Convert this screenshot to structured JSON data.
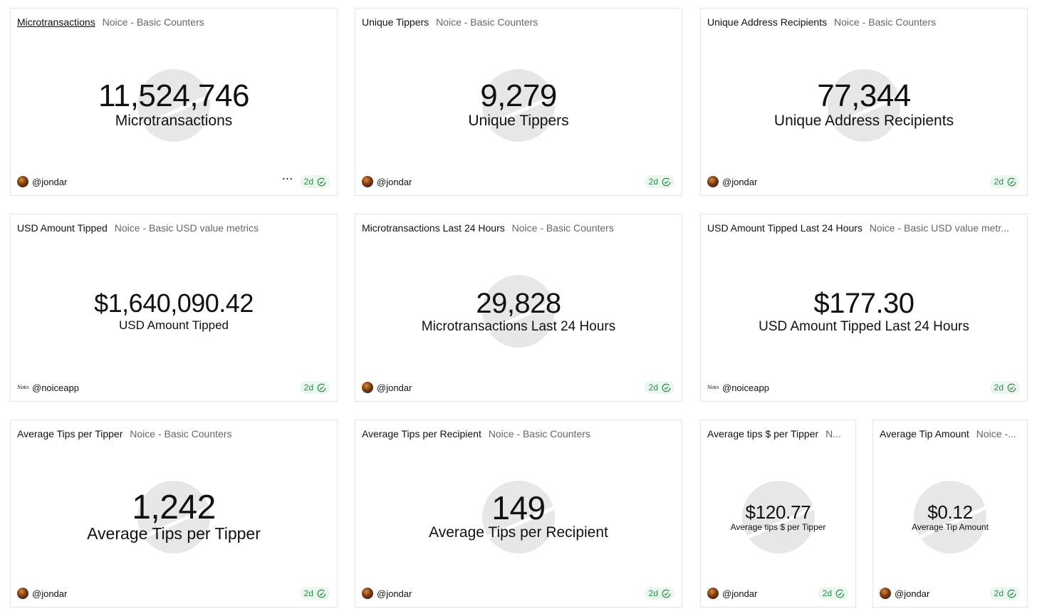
{
  "cards": [
    {
      "title": "Microtransactions",
      "source": "Noice - Basic Counters",
      "value": "11,524,746",
      "label": "Microtransactions",
      "owner": "@jondar",
      "age": "2d"
    },
    {
      "title": "Unique Tippers",
      "source": "Noice - Basic Counters",
      "value": "9,279",
      "label": "Unique Tippers",
      "owner": "@jondar",
      "age": "2d"
    },
    {
      "title": "Unique Address Recipients",
      "source": "Noice - Basic Counters",
      "value": "77,344",
      "label": "Unique Address Recipients",
      "owner": "@jondar",
      "age": "2d"
    },
    {
      "title": "USD Amount Tipped",
      "source": "Noice - Basic USD value metrics",
      "value": "$1,640,090.42",
      "label": "USD Amount Tipped",
      "owner": "@noiceapp",
      "owner_avatar_text": "Noice",
      "age": "2d"
    },
    {
      "title": "Microtransactions Last 24 Hours",
      "source": "Noice - Basic Counters",
      "value": "29,828",
      "label": "Microtransactions Last 24 Hours",
      "owner": "@jondar",
      "age": "2d"
    },
    {
      "title": "USD Amount Tipped Last 24 Hours",
      "source": "Noice - Basic USD value metr...",
      "value": "$177.30",
      "label": "USD Amount Tipped Last 24 Hours",
      "owner": "@noiceapp",
      "owner_avatar_text": "Noice",
      "age": "2d"
    },
    {
      "title": "Average Tips per Tipper",
      "source": "Noice - Basic Counters",
      "value": "1,242",
      "label": "Average Tips per Tipper",
      "owner": "@jondar",
      "age": "2d"
    },
    {
      "title": "Average Tips per Recipient",
      "source": "Noice - Basic Counters",
      "value": "149",
      "label": "Average Tips per Recipient",
      "owner": "@jondar",
      "age": "2d"
    },
    {
      "title": "Average tips $ per Tipper",
      "source": "N...",
      "value": "$120.77",
      "label": "Average tips $ per Tipper",
      "owner": "@jondar",
      "age": "2d"
    },
    {
      "title": "Average Tip Amount",
      "source": "Noice -...",
      "value": "$0.12",
      "label": "Average Tip Amount",
      "owner": "@jondar",
      "age": "2d"
    }
  ],
  "more_icon": "⋯"
}
